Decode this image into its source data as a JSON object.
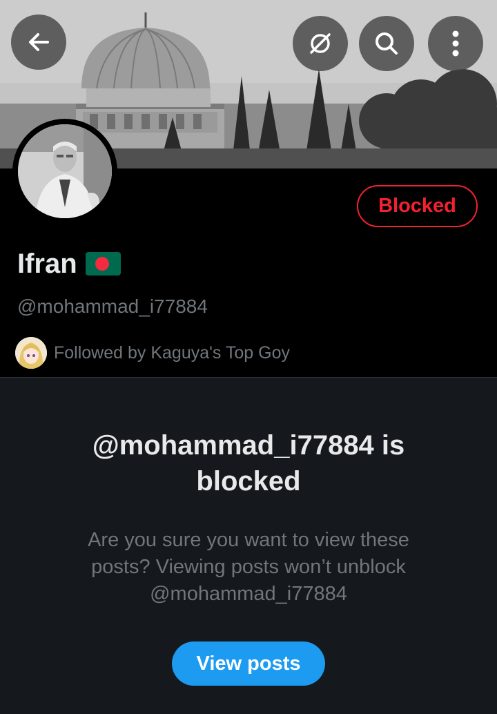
{
  "header": {
    "back_icon": "arrow-left-icon",
    "grok_icon": "grok-icon",
    "search_icon": "search-icon",
    "more_icon": "more-vertical-icon"
  },
  "profile": {
    "name": "Ifran",
    "flag_icon": "bangladesh-flag-icon",
    "handle": "@mohammad_i77884",
    "followed_by": "Followed by Kaguya's Top Goy",
    "blocked_label": "Blocked"
  },
  "blocked_notice": {
    "title": "@mohammad_i77884 is blocked",
    "body": "Are you sure you want to view these posts? Viewing posts won’t unblock @mohammad_i77884",
    "button_label": "View posts"
  },
  "colors": {
    "background": "#000000",
    "panel": "#15181c",
    "danger": "#f4212e",
    "accent": "#1d9bf0",
    "text_primary": "#e7e9ea",
    "text_secondary": "#71767b"
  }
}
